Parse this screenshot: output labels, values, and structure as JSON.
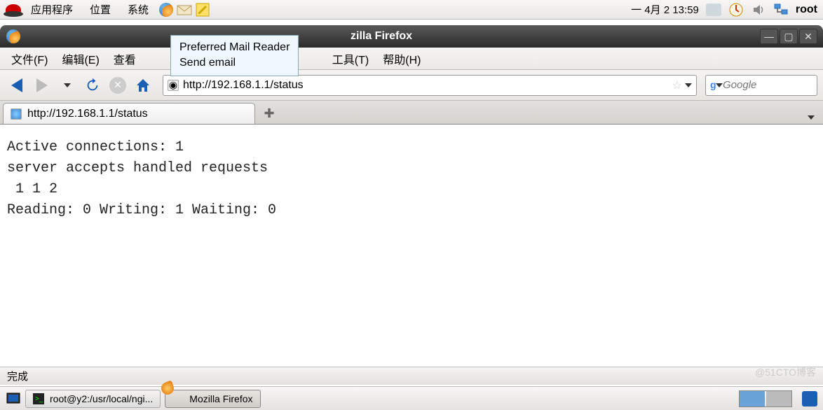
{
  "gnome": {
    "apps": "应用程序",
    "places": "位置",
    "system": "系统",
    "date": "一  4月  2 13:59",
    "user": "root"
  },
  "tooltip": {
    "line1": "Preferred Mail Reader",
    "line2": "Send email"
  },
  "window": {
    "title_visible": "zilla Firefox"
  },
  "menus": {
    "file": "文件(F)",
    "edit": "编辑(E)",
    "view_partial": "查看",
    "tools": "工具(T)",
    "help": "帮助(H)"
  },
  "urlbar": {
    "url": "http://192.168.1.1/status"
  },
  "searchbar": {
    "placeholder": "Google"
  },
  "tab": {
    "title": "http://192.168.1.1/status"
  },
  "page": {
    "line1": "Active connections: 1 ",
    "line2": "server accepts handled requests",
    "line3": " 1 1 2 ",
    "line4": "Reading: 0 Writing: 1 Waiting: 0 "
  },
  "statusbar": {
    "text": "完成"
  },
  "taskbar": {
    "terminal": "root@y2:/usr/local/ngi...",
    "firefox": "Mozilla Firefox"
  },
  "watermark": "@51CTO博客"
}
